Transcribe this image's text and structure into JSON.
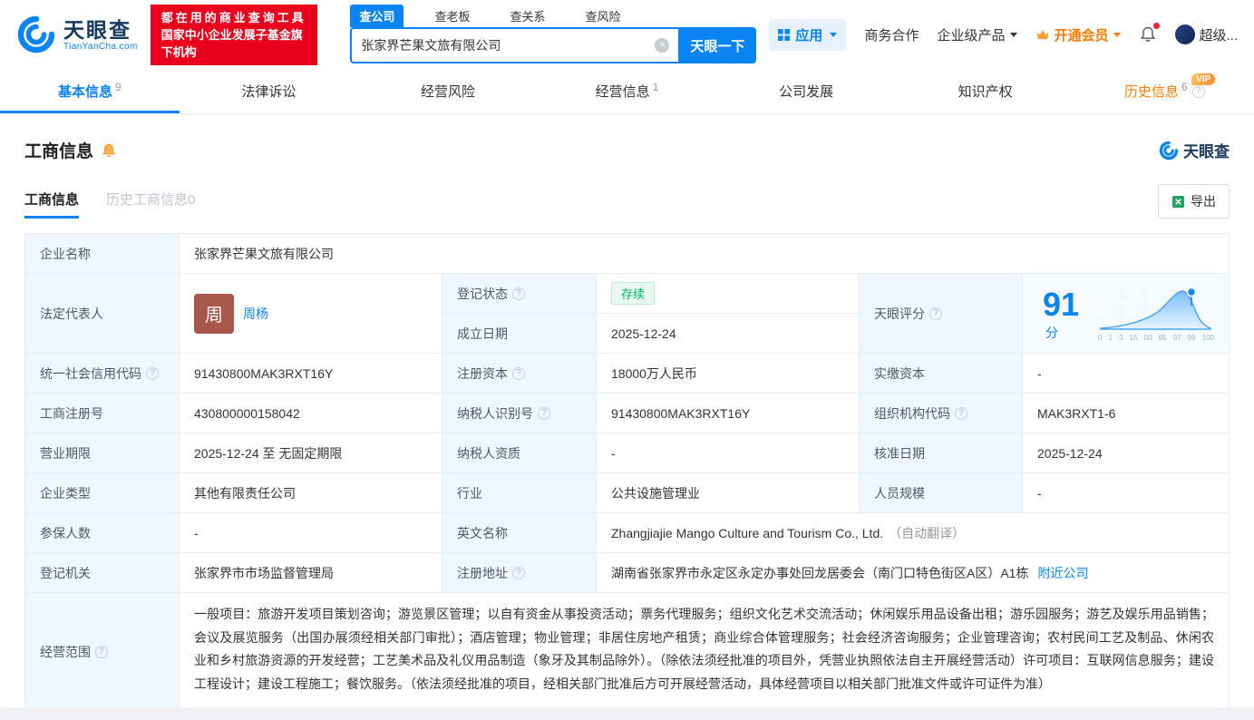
{
  "header": {
    "logo": {
      "brand": "天眼查",
      "domain": "TianYanCha.com"
    },
    "promo": {
      "line1": "都在用的商业查询工具",
      "line2": "国家中小企业发展子基金旗下机构"
    },
    "search": {
      "tabs": [
        {
          "label": "查公司"
        },
        {
          "label": "查老板"
        },
        {
          "label": "查关系"
        },
        {
          "label": "查风险"
        }
      ],
      "value": "张家界芒果文旅有限公司",
      "button": "天眼一下"
    },
    "menu": {
      "apps": "应用",
      "cooperation": "商务合作",
      "enterprise": "企业级产品",
      "vip": "开通会员",
      "super": "超级..."
    }
  },
  "nav": {
    "tabs": [
      {
        "label": "基本信息",
        "count": "9"
      },
      {
        "label": "法律诉讼"
      },
      {
        "label": "经营风险"
      },
      {
        "label": "经营信息",
        "count": "1"
      },
      {
        "label": "公司发展"
      },
      {
        "label": "知识产权"
      },
      {
        "label": "历史信息",
        "count": "6",
        "badge": "VIP"
      }
    ]
  },
  "section": {
    "title": "工商信息",
    "brand": "天眼查",
    "sub_tabs": [
      {
        "label": "工商信息"
      },
      {
        "label": "历史工商信息0"
      }
    ],
    "export_label": "导出"
  },
  "fields": {
    "company_name": {
      "label": "企业名称",
      "value": "张家界芒果文旅有限公司"
    },
    "legal_rep": {
      "label": "法定代表人",
      "avatar": "周",
      "value": "周杨"
    },
    "reg_status": {
      "label": "登记状态",
      "value": "存续"
    },
    "establish_date": {
      "label": "成立日期",
      "value": "2025-12-24"
    },
    "score": {
      "label": "天眼评分",
      "value": "91",
      "unit": "分",
      "ticks": [
        "0",
        "1",
        "3",
        "15",
        "50",
        "85",
        "97",
        "99",
        "100"
      ]
    },
    "credit_code": {
      "label": "统一社会信用代码",
      "value": "91430800MAK3RXT16Y"
    },
    "reg_capital": {
      "label": "注册资本",
      "value": "18000万人民币"
    },
    "paid_capital": {
      "label": "实缴资本",
      "value": "-"
    },
    "reg_number": {
      "label": "工商注册号",
      "value": "430800000158042"
    },
    "taxpayer_id": {
      "label": "纳税人识别号",
      "value": "91430800MAK3RXT16Y"
    },
    "org_code": {
      "label": "组织机构代码",
      "value": "MAK3RXT1-6"
    },
    "business_term": {
      "label": "营业期限",
      "value": "2025-12-24 至 无固定期限"
    },
    "taxpayer_quality": {
      "label": "纳税人资质",
      "value": "-"
    },
    "approval_date": {
      "label": "核准日期",
      "value": "2025-12-24"
    },
    "company_type": {
      "label": "企业类型",
      "value": "其他有限责任公司"
    },
    "industry": {
      "label": "行业",
      "value": "公共设施管理业"
    },
    "staff_size": {
      "label": "人员规模",
      "value": "-"
    },
    "insured_count": {
      "label": "参保人数",
      "value": "-"
    },
    "english_name": {
      "label": "英文名称",
      "value": "Zhangjiajie Mango Culture and Tourism Co., Ltd.",
      "note": "（自动翻译）"
    },
    "reg_authority": {
      "label": "登记机关",
      "value": "张家界市市场监督管理局"
    },
    "reg_address": {
      "label": "注册地址",
      "value": "湖南省张家界市永定区永定办事处回龙居委会（南门口特色街区A区）A1栋",
      "link": "附近公司"
    },
    "business_scope": {
      "label": "经营范围",
      "value": "一般项目：旅游开发项目策划咨询；游览景区管理；以自有资金从事投资活动；票务代理服务；组织文化艺术交流活动；休闲娱乐用品设备出租；游乐园服务；游艺及娱乐用品销售；会议及展览服务（出国办展须经相关部门审批）；酒店管理；物业管理；非居住房地产租赁；商业综合体管理服务；社会经济咨询服务；企业管理咨询；农村民间工艺及制品、休闲农业和乡村旅游资源的开发经营；工艺美术品及礼仪用品制造（象牙及其制品除外）。（除依法须经批准的项目外，凭营业执照依法自主开展经营活动）许可项目：互联网信息服务；建设工程设计；建设工程施工；餐饮服务。（依法须经批准的项目，经相关部门批准后方可开展经营活动，具体经营项目以相关部门批准文件或许可证件为准）"
    }
  }
}
